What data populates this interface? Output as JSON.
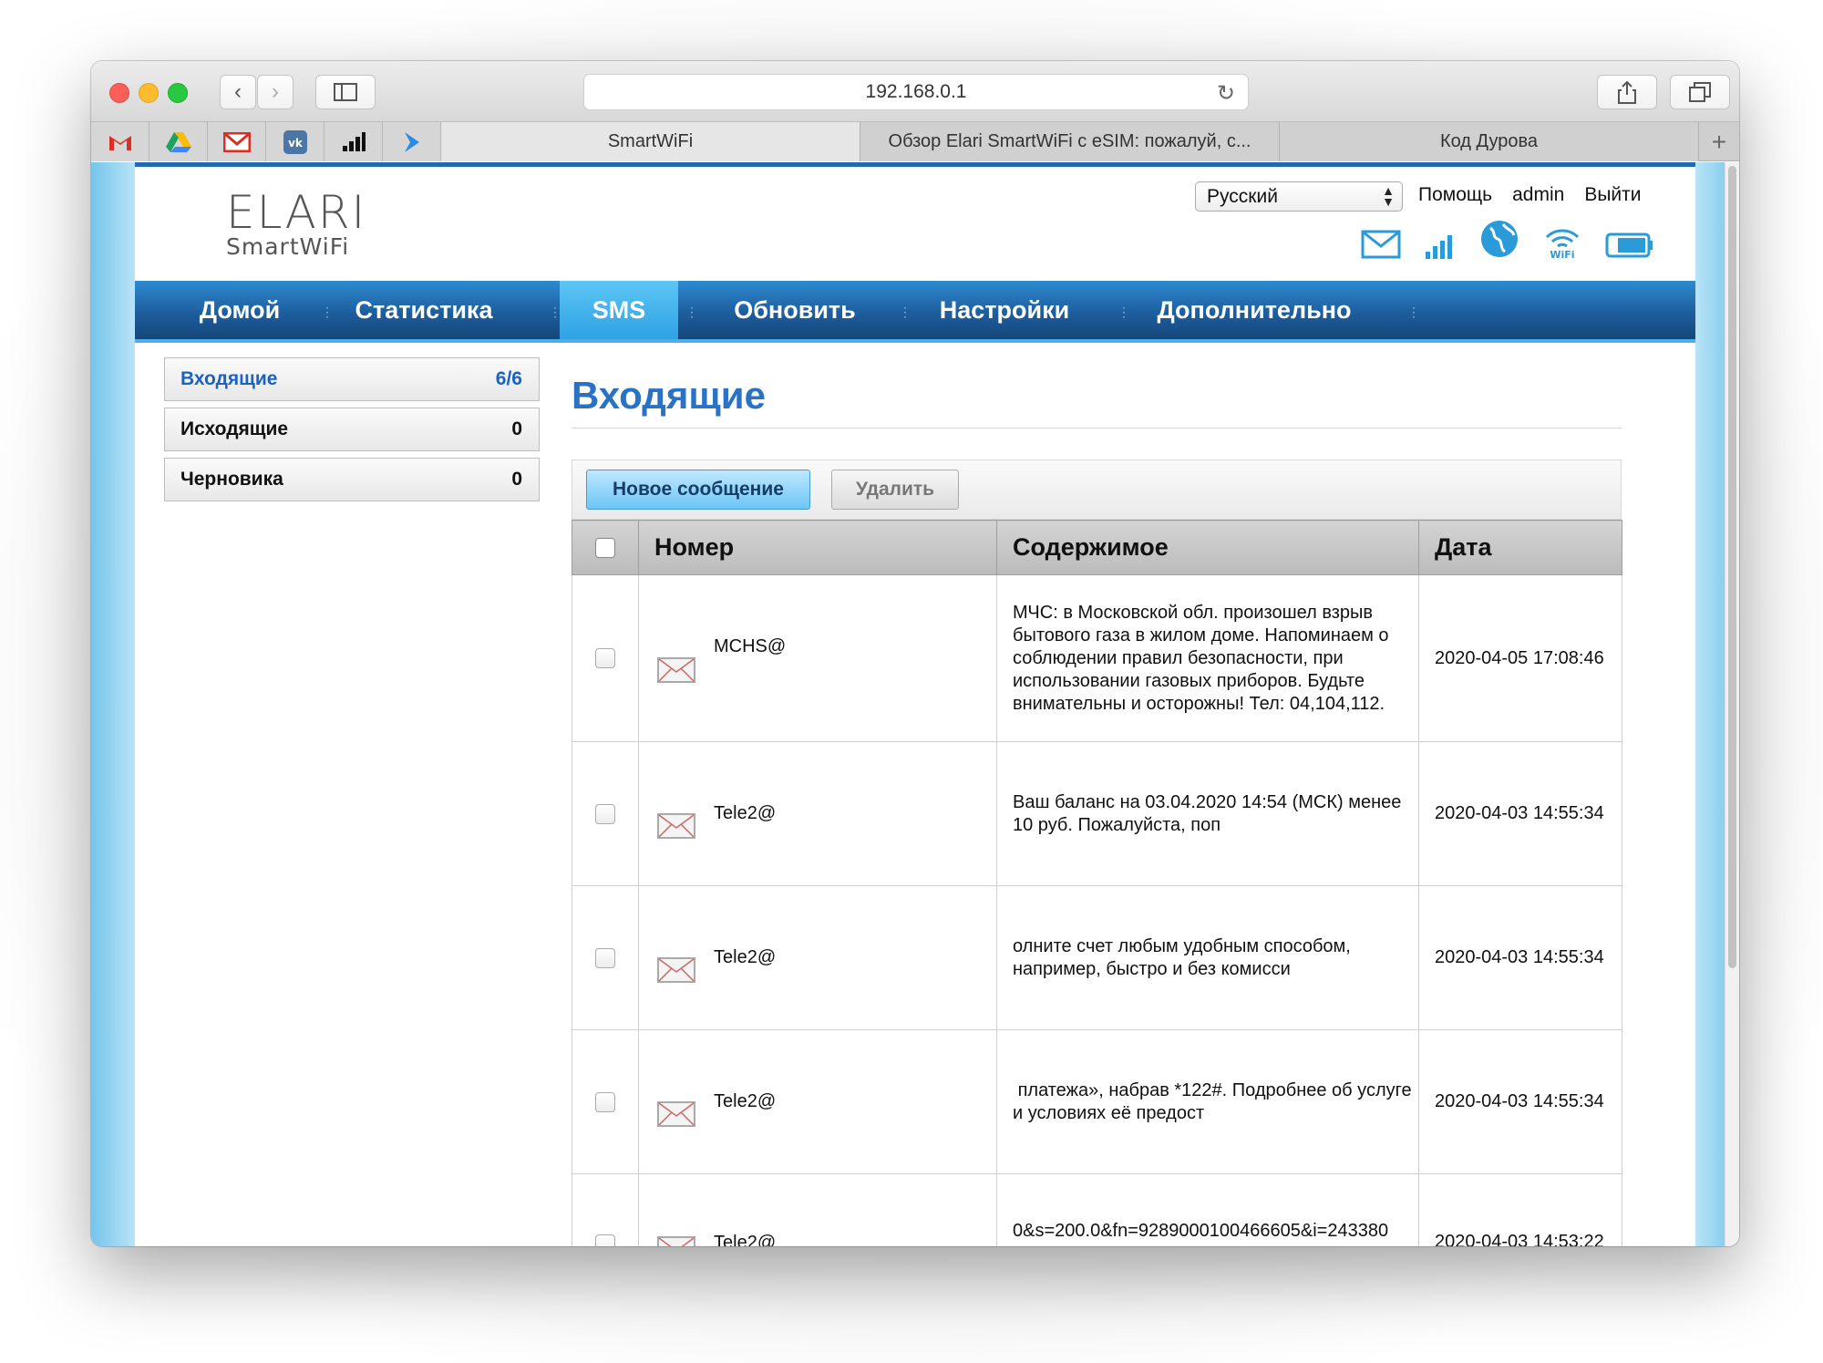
{
  "browser": {
    "url": "192.168.0.1",
    "tabs": [
      {
        "label": "SmartWiFi",
        "active": true
      },
      {
        "label": "Обзор Elari SmartWiFi с eSIM: пожалуй, с...",
        "active": false
      },
      {
        "label": "Код Дурова",
        "active": false
      }
    ],
    "new_tab": "+"
  },
  "header": {
    "logo_top": "ELARI",
    "logo_bottom": "SmartWiFi",
    "language": "Русский",
    "links": {
      "help": "Помощь",
      "user": "admin",
      "logout": "Выйти"
    }
  },
  "nav": {
    "items": [
      "Домой",
      "Статистика",
      "SMS",
      "Обновить",
      "Настройки",
      "Дополнительно"
    ],
    "active": "SMS"
  },
  "sidebar": {
    "items": [
      {
        "label": "Входящие",
        "count": "6/6",
        "active": true
      },
      {
        "label": "Исходящие",
        "count": "0",
        "active": false
      },
      {
        "label": "Черновика",
        "count": "0",
        "active": false
      }
    ]
  },
  "main": {
    "title": "Входящие",
    "new_button": "Новое сообщение",
    "delete_button": "Удалить",
    "columns": {
      "number": "Номер",
      "content": "Содержимое",
      "date": "Дата"
    },
    "rows": [
      {
        "number": "MCHS@",
        "content": "МЧС: в Московской обл. произошел взрыв бытового газа в жилом доме. Напоминаем о соблюдении правил безопасности, при использовании газовых приборов. Будьте внимательны и осторожны! Тел: 04,104,112.",
        "date": "2020-04-05 17:08:46"
      },
      {
        "number": "Tele2@",
        "content": "Ваш баланс на 03.04.2020 14:54 (МСК) менее 10 руб. Пожалуйста, поп",
        "date": "2020-04-03 14:55:34"
      },
      {
        "number": "Tele2@",
        "content": "олните счет любым удобным способом, например, быстро и без комисси",
        "date": "2020-04-03 14:55:34"
      },
      {
        "number": "Tele2@",
        "content": " платежа», набрав *122#. Подробнее об услуге и условиях её предост",
        "date": "2020-04-03 14:55:34"
      },
      {
        "number": "Tele2@",
        "content": "0&s=200.0&fn=9289000100466605&i=243380",
        "date": "2020-04-03 14:53:22"
      }
    ]
  },
  "colors": {
    "nav_blue": "#1d5e9e",
    "active_tab": "#2ea2e3",
    "title_blue": "#2a72c4"
  }
}
